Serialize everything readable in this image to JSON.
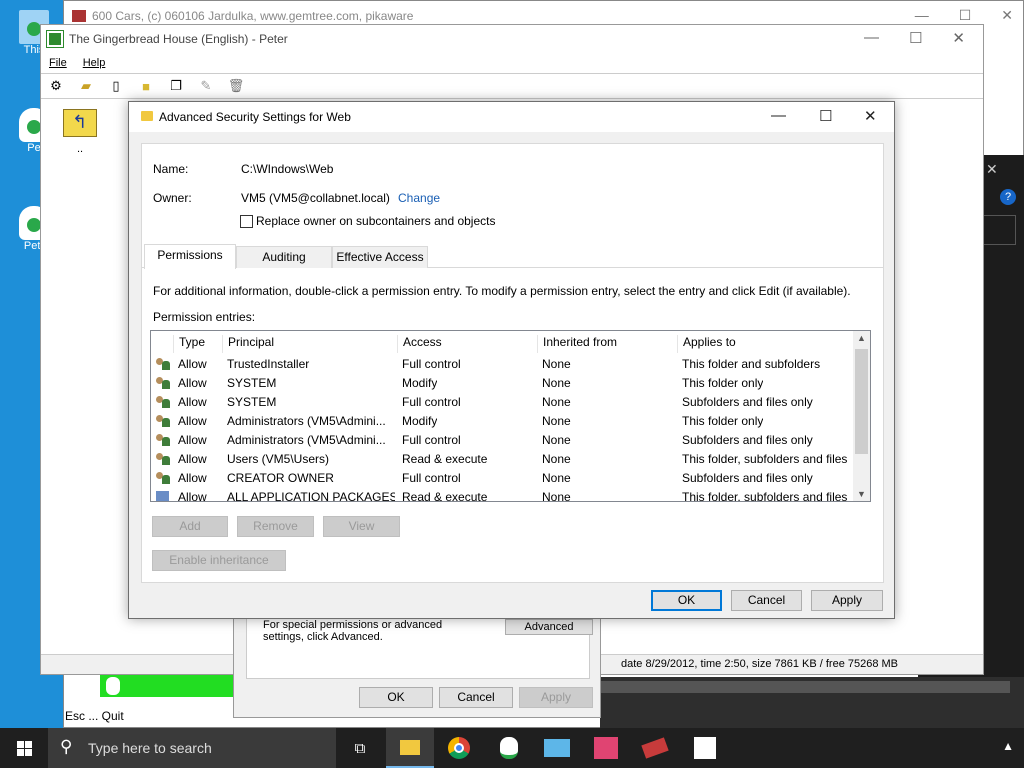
{
  "desktop": {
    "icons": [
      {
        "label": "This"
      },
      {
        "label": "Pe"
      },
      {
        "label": "Petr"
      }
    ]
  },
  "cars_window": {
    "title": "600 Cars, (c) 060106 Jardulka, www.gemtree.com, pikaware",
    "quit_text": "Esc ... Quit",
    "help_glyph": "?"
  },
  "ginger_window": {
    "title": "The Gingerbread House (English) - Peter",
    "menu": {
      "file": "File",
      "help": "Help"
    },
    "ellipsis": "..",
    "status": "date 8/29/2012, time 2:50, size 7861 KB / free 75268 MB"
  },
  "properties_dialog": {
    "hint": "For special permissions or advanced settings, click Advanced.",
    "advanced_label": "Advanced",
    "ok_label": "OK",
    "cancel_label": "Cancel",
    "apply_label": "Apply"
  },
  "advanced_dialog": {
    "title": "Advanced Security Settings for Web",
    "name_label": "Name:",
    "name_value": "C:\\WIndows\\Web",
    "owner_label": "Owner:",
    "owner_value": "VM5 (VM5@collabnet.local)",
    "change_label": "Change",
    "replace_owner_label": "Replace owner on subcontainers and objects",
    "tabs": [
      "Permissions",
      "Auditing",
      "Effective Access"
    ],
    "info_text": "For additional information, double-click a permission entry. To modify a permission entry, select the entry and click Edit (if available).",
    "entries_label": "Permission entries:",
    "columns": [
      "Type",
      "Principal",
      "Access",
      "Inherited from",
      "Applies to"
    ],
    "rows": [
      [
        "Allow",
        "TrustedInstaller",
        "Full control",
        "None",
        "This folder and subfolders"
      ],
      [
        "Allow",
        "SYSTEM",
        "Modify",
        "None",
        "This folder only"
      ],
      [
        "Allow",
        "SYSTEM",
        "Full control",
        "None",
        "Subfolders and files only"
      ],
      [
        "Allow",
        "Administrators (VM5\\Admini...",
        "Modify",
        "None",
        "This folder only"
      ],
      [
        "Allow",
        "Administrators (VM5\\Admini...",
        "Full control",
        "None",
        "Subfolders and files only"
      ],
      [
        "Allow",
        "Users (VM5\\Users)",
        "Read & execute",
        "None",
        "This folder, subfolders and files"
      ],
      [
        "Allow",
        "CREATOR OWNER",
        "Full control",
        "None",
        "Subfolders and files only"
      ],
      [
        "Allow",
        "ALL APPLICATION PACKAGES",
        "Read & execute",
        "None",
        "This folder, subfolders and files"
      ]
    ],
    "add_label": "Add",
    "remove_label": "Remove",
    "view_label": "View",
    "enable_inheritance_label": "Enable inheritance",
    "ok_label": "OK",
    "cancel_label": "Cancel",
    "apply_label": "Apply"
  },
  "taskbar": {
    "search_placeholder": "Type here to search"
  }
}
